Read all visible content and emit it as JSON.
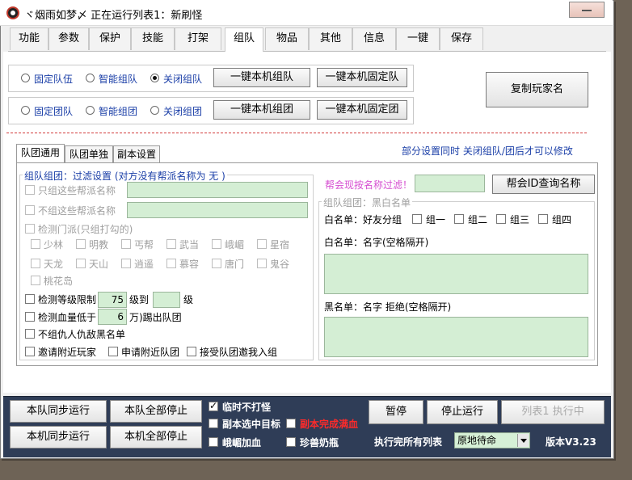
{
  "window": {
    "title": "ヾ烟雨如梦〆  正在运行列表1：新刷怪"
  },
  "tabs": [
    {
      "label": "功能",
      "active": false
    },
    {
      "label": "参数",
      "active": false
    },
    {
      "label": "保护",
      "active": false
    },
    {
      "label": "技能",
      "active": false
    },
    {
      "label": "打架",
      "active": false
    },
    {
      "label": "组队",
      "active": true
    },
    {
      "label": "物品",
      "active": false
    },
    {
      "label": "其他",
      "active": false
    },
    {
      "label": "信息",
      "active": false
    },
    {
      "label": "一键",
      "active": false
    },
    {
      "label": "保存",
      "active": false
    }
  ],
  "team": {
    "radios": [
      {
        "label": "固定队伍",
        "checked": false
      },
      {
        "label": "智能组队",
        "checked": false
      },
      {
        "label": "关闭组队",
        "checked": true
      }
    ],
    "btn_local_team": "一键本机组队",
    "btn_local_fixed_team": "一键本机固定队"
  },
  "group": {
    "radios": [
      {
        "label": "固定团队",
        "checked": false
      },
      {
        "label": "智能组团",
        "checked": false
      },
      {
        "label": "关闭组团",
        "checked": false
      }
    ],
    "btn_local_group": "一键本机组团",
    "btn_local_fixed_group": "一键本机固定团"
  },
  "copy_player_name": "复制玩家名",
  "subtabs": [
    {
      "label": "队团通用",
      "active": true
    },
    {
      "label": "队团单独",
      "active": false
    },
    {
      "label": "副本设置",
      "active": false
    }
  ],
  "notice": "部分设置同时 关闭组队/团后才可以修改",
  "filter": {
    "legend": "组队组团：过滤设置 (对方没有帮派名称为 无 )",
    "only_guild": "只组这些帮派名称",
    "not_guild": "不组这些帮派名称",
    "detect_sect": "检测门派(只组打勾的)",
    "sects_row1": [
      "少林",
      "明教",
      "丐帮",
      "武当",
      "峨嵋",
      "星宿"
    ],
    "sects_row2": [
      "天龙",
      "天山",
      "逍遥",
      "慕容",
      "唐门",
      "鬼谷"
    ],
    "sects_row3": [
      "桃花岛"
    ],
    "level_limit_label": "检测等级限制",
    "level_min": "75",
    "level_to": "级到",
    "level_max": "",
    "level_unit": "级",
    "hp_label": "检测血量低于",
    "hp_value": "6",
    "hp_unit": "万)踢出队团",
    "no_enemy": "不组仇人仇敌黑名单",
    "invite_nearby": "邀请附近玩家",
    "apply_nearby": "申请附近队团",
    "accept_invite": "接受队团邀我入组"
  },
  "guild_filter": {
    "label": "帮会现按名称过滤！",
    "value": "",
    "btn_query": "帮会ID查询名称"
  },
  "blackwhite": {
    "legend": "组队组团：黑白名单",
    "whitelist_friend": "白名单：好友分组",
    "groups": [
      "组一",
      "组二",
      "组三",
      "组四"
    ],
    "whitelist_name": "白名单：名字(空格隔开)",
    "blacklist_name": "黑名单：名字 拒绝(空格隔开)"
  },
  "bottom": {
    "btn_team_sync": "本队同步运行",
    "btn_team_stop_all": "本队全部停止",
    "btn_local_sync": "本机同步运行",
    "btn_local_stop_all": "本机全部停止",
    "temp_no_fight": "临时不打怪",
    "temp_no_fight_checked": true,
    "dungeon_target": "副本选中目标",
    "dungeon_complete": "副本完成满血",
    "emei_heal": "峨嵋加血",
    "pet_milk": "珍兽奶瓶",
    "btn_pause": "暂停",
    "btn_stop_run": "停止运行",
    "btn_list_exec": "列表1 执行中",
    "exec_all_label": "执行完所有列表",
    "select_value": "原地待命",
    "version": "版本V3.23"
  },
  "colors": {
    "bottom_bg": "#2f3d57",
    "field_green": "#d4eed4",
    "notice_blue": "#1a3ea7",
    "pink_label": "#d64fd1",
    "red_text": "#ff2a2a"
  }
}
